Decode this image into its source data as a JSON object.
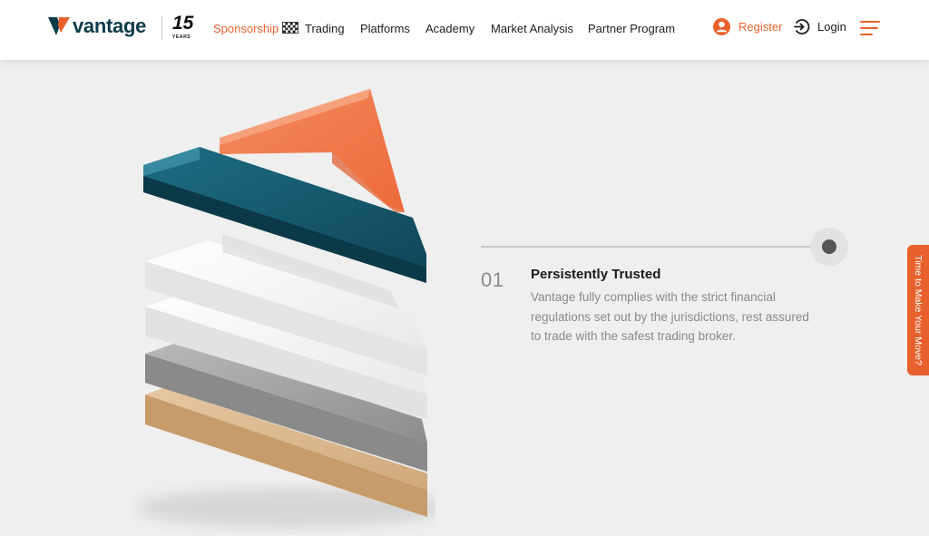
{
  "header": {
    "logo_text": "vantage",
    "badge_number": "15",
    "badge_subtext": "YEARS",
    "nav": [
      {
        "label": "Sponsorship",
        "active": true
      },
      {
        "label": "Trading"
      },
      {
        "label": "Platforms"
      },
      {
        "label": "Academy"
      },
      {
        "label": "Market Analysis"
      },
      {
        "label": "Partner Program"
      }
    ],
    "register_label": "Register",
    "login_label": "Login"
  },
  "feature": {
    "number": "01",
    "title": "Persistently Trusted",
    "description": "Vantage fully complies with the strict financial regulations set out by the jurisdictions, rest assured to trade with the safest trading broker."
  },
  "side_tab": {
    "label": "Time to Make Your Move?"
  },
  "colors": {
    "accent": "#e8612c",
    "brand_dark": "#0d3b4a",
    "teal": "#165a6e",
    "background": "#efefef"
  },
  "icons": {
    "register": "user-circle-icon",
    "login": "login-arrow-icon",
    "menu": "hamburger-menu-icon",
    "sponsorship": "checkered-flag-icon"
  }
}
